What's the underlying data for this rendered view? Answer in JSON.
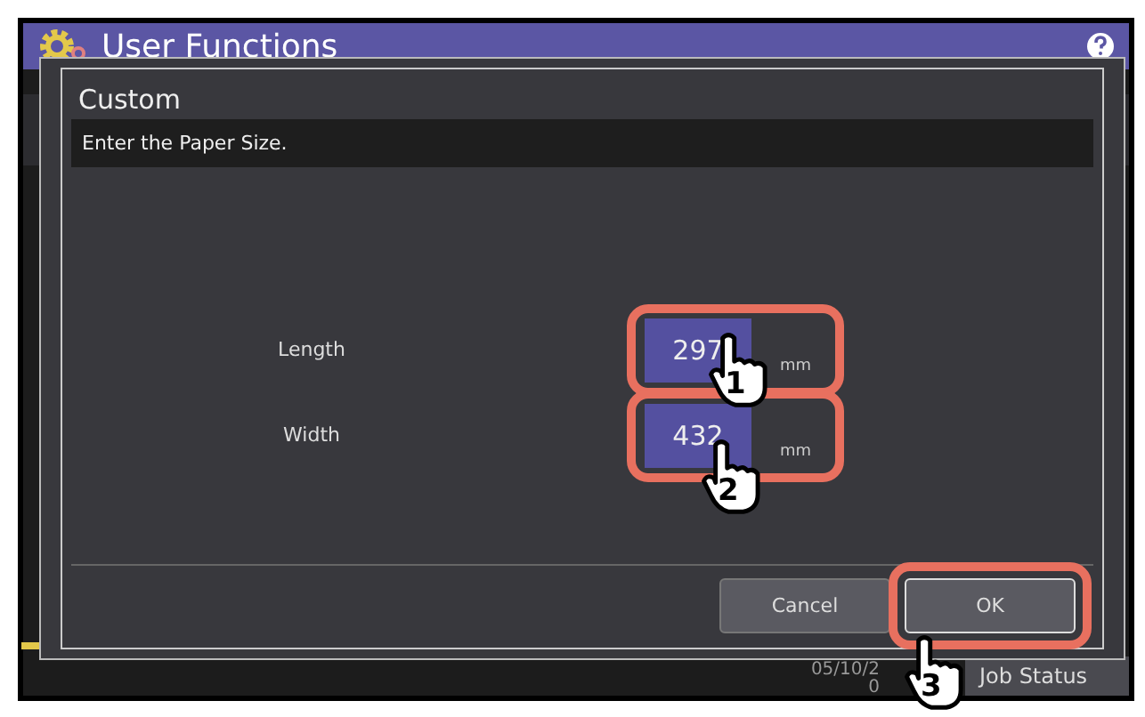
{
  "window": {
    "title": "User Functions"
  },
  "dialog": {
    "title": "Custom",
    "message": "Enter the Paper Size.",
    "fields": [
      {
        "label": "Length",
        "value": "297",
        "unit": "mm",
        "highlighted": true
      },
      {
        "label": "Width",
        "value": "432",
        "unit": "mm",
        "highlighted": true
      }
    ],
    "buttons": [
      {
        "label": "Cancel",
        "highlighted": false
      },
      {
        "label": "OK",
        "highlighted": true
      }
    ]
  },
  "callouts": [
    "1",
    "2",
    "3"
  ],
  "status_bar": {
    "date": "05/10/2",
    "time": "0",
    "job_status": "Job Status"
  }
}
